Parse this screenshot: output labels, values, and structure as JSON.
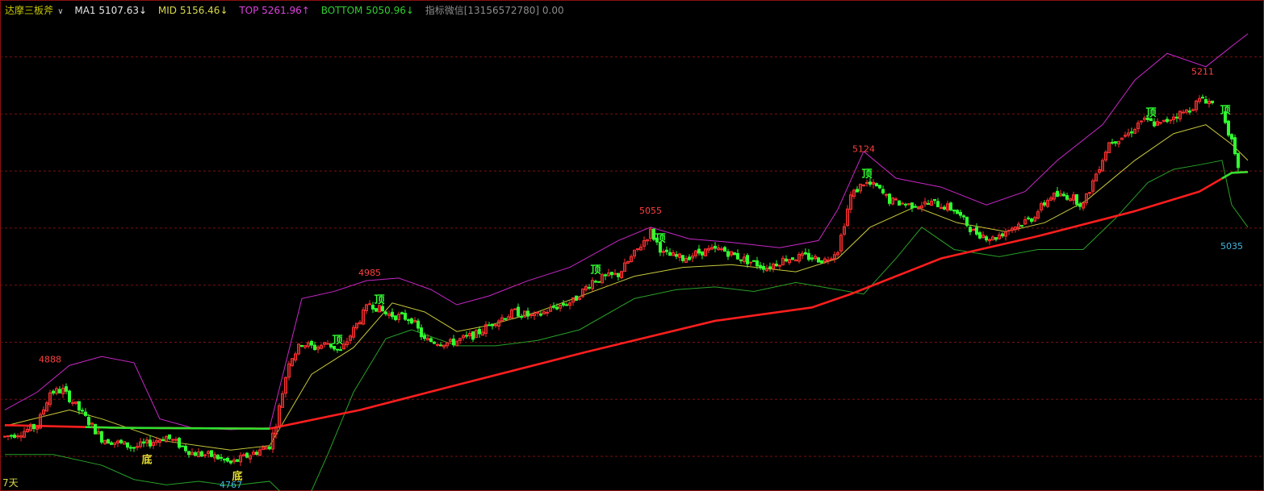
{
  "legend": {
    "indicator_name": "达摩三板斧",
    "ma1": "MA1 5107.63",
    "ma1_arrow": "↓",
    "mid": "MID 5156.46",
    "mid_arrow": "↓",
    "top": "TOP 5261.96",
    "top_arrow": "↑",
    "bottom": "BOTTOM 5050.96",
    "bottom_arrow": "↓",
    "note": "指标微信[13156572780] 0.00"
  },
  "period_label": "7天",
  "colors": {
    "up": "#ff3030",
    "down": "#30ff30",
    "mid_line": "#c8c83c",
    "top_band": "#c828c8",
    "bottom_band": "#28a028",
    "ma_line": "#ff1e1e",
    "ma_line_flat": "#30e030",
    "grid": "#7a1010",
    "label_high": "#ff4040",
    "label_low": "#40b8e0",
    "top_mark": "#30ff30",
    "bottom_mark": "#e8e030"
  },
  "chart_data": {
    "type": "candlestick",
    "ylim": [
      4750,
      5280
    ],
    "y_gridlines": [
      4788,
      4852,
      4916,
      4980,
      5044,
      5108,
      5172,
      5236
    ],
    "annotations": [
      {
        "text": "4888",
        "kind": "high",
        "bar": 14,
        "value": 4888
      },
      {
        "text": "4767",
        "kind": "low",
        "bar": 70,
        "value": 4767
      },
      {
        "text": "4985",
        "kind": "high",
        "bar": 113,
        "value": 4985
      },
      {
        "text": "5055",
        "kind": "high",
        "bar": 200,
        "value": 5055
      },
      {
        "text": "5124",
        "kind": "high",
        "bar": 266,
        "value": 5124
      },
      {
        "text": "5211",
        "kind": "high",
        "bar": 371,
        "value": 5211
      },
      {
        "text": "5035",
        "kind": "low",
        "bar": 380,
        "value": 5035
      }
    ],
    "signal_marks": [
      {
        "text": "底",
        "kind": "bottom",
        "bar": 44
      },
      {
        "text": "底",
        "kind": "bottom",
        "bar": 72
      },
      {
        "text": "顶",
        "kind": "top",
        "bar": 103
      },
      {
        "text": "顶",
        "kind": "top",
        "bar": 116
      },
      {
        "text": "顶",
        "kind": "top",
        "bar": 183
      },
      {
        "text": "顶",
        "kind": "top",
        "bar": 203
      },
      {
        "text": "顶",
        "kind": "top",
        "bar": 267
      },
      {
        "text": "顶",
        "kind": "top",
        "bar": 355
      },
      {
        "text": "顶",
        "kind": "top",
        "bar": 378
      }
    ],
    "price_path": [
      [
        0,
        4810
      ],
      [
        5,
        4815
      ],
      [
        10,
        4822
      ],
      [
        14,
        4860
      ],
      [
        18,
        4862
      ],
      [
        22,
        4845
      ],
      [
        30,
        4808
      ],
      [
        40,
        4798
      ],
      [
        44,
        4802
      ],
      [
        50,
        4810
      ],
      [
        58,
        4792
      ],
      [
        65,
        4788
      ],
      [
        70,
        4780
      ],
      [
        76,
        4790
      ],
      [
        82,
        4800
      ],
      [
        84,
        4825
      ],
      [
        88,
        4895
      ],
      [
        92,
        4915
      ],
      [
        96,
        4910
      ],
      [
        100,
        4915
      ],
      [
        104,
        4905
      ],
      [
        108,
        4930
      ],
      [
        113,
        4960
      ],
      [
        118,
        4948
      ],
      [
        126,
        4942
      ],
      [
        130,
        4918
      ],
      [
        138,
        4915
      ],
      [
        146,
        4925
      ],
      [
        152,
        4940
      ],
      [
        158,
        4950
      ],
      [
        164,
        4944
      ],
      [
        170,
        4955
      ],
      [
        176,
        4962
      ],
      [
        182,
        4985
      ],
      [
        190,
        4992
      ],
      [
        196,
        5020
      ],
      [
        200,
        5040
      ],
      [
        204,
        5015
      ],
      [
        210,
        5010
      ],
      [
        216,
        5018
      ],
      [
        222,
        5020
      ],
      [
        228,
        5010
      ],
      [
        232,
        5005
      ],
      [
        236,
        5000
      ],
      [
        242,
        5010
      ],
      [
        248,
        5012
      ],
      [
        254,
        5008
      ],
      [
        258,
        5020
      ],
      [
        262,
        5080
      ],
      [
        266,
        5095
      ],
      [
        270,
        5090
      ],
      [
        274,
        5075
      ],
      [
        280,
        5070
      ],
      [
        288,
        5072
      ],
      [
        294,
        5065
      ],
      [
        300,
        5040
      ],
      [
        306,
        5032
      ],
      [
        312,
        5045
      ],
      [
        318,
        5055
      ],
      [
        324,
        5080
      ],
      [
        330,
        5080
      ],
      [
        334,
        5070
      ],
      [
        338,
        5105
      ],
      [
        342,
        5140
      ],
      [
        348,
        5150
      ],
      [
        352,
        5165
      ],
      [
        358,
        5160
      ],
      [
        362,
        5170
      ],
      [
        366,
        5175
      ],
      [
        371,
        5190
      ],
      [
        376,
        5180
      ],
      [
        378,
        5165
      ],
      [
        380,
        5140
      ],
      [
        382,
        5108
      ]
    ],
    "ma1_path": [
      [
        0,
        4823
      ],
      [
        35,
        4820
      ],
      [
        82,
        4819
      ],
      [
        86,
        4822
      ],
      [
        110,
        4840
      ],
      [
        140,
        4868
      ],
      [
        180,
        4905
      ],
      [
        220,
        4940
      ],
      [
        250,
        4955
      ],
      [
        262,
        4970
      ],
      [
        290,
        5010
      ],
      [
        320,
        5035
      ],
      [
        350,
        5063
      ],
      [
        370,
        5085
      ],
      [
        380,
        5106
      ],
      [
        385,
        5107
      ]
    ],
    "ma1_flat_range": [
      25,
      82
    ],
    "ma1_tail_flat": [
      377,
      385
    ],
    "mid_path": [
      [
        0,
        4822
      ],
      [
        20,
        4840
      ],
      [
        30,
        4830
      ],
      [
        50,
        4805
      ],
      [
        70,
        4795
      ],
      [
        82,
        4800
      ],
      [
        95,
        4880
      ],
      [
        108,
        4910
      ],
      [
        120,
        4960
      ],
      [
        130,
        4950
      ],
      [
        140,
        4928
      ],
      [
        150,
        4935
      ],
      [
        165,
        4950
      ],
      [
        180,
        4970
      ],
      [
        195,
        4990
      ],
      [
        210,
        5000
      ],
      [
        225,
        5003
      ],
      [
        245,
        4995
      ],
      [
        258,
        5010
      ],
      [
        268,
        5045
      ],
      [
        282,
        5068
      ],
      [
        295,
        5050
      ],
      [
        310,
        5040
      ],
      [
        322,
        5050
      ],
      [
        335,
        5075
      ],
      [
        350,
        5120
      ],
      [
        362,
        5150
      ],
      [
        372,
        5160
      ],
      [
        380,
        5138
      ],
      [
        385,
        5120
      ]
    ],
    "top_path": [
      [
        0,
        4840
      ],
      [
        10,
        4860
      ],
      [
        20,
        4890
      ],
      [
        30,
        4900
      ],
      [
        40,
        4893
      ],
      [
        48,
        4830
      ],
      [
        58,
        4820
      ],
      [
        70,
        4818
      ],
      [
        82,
        4820
      ],
      [
        92,
        4965
      ],
      [
        102,
        4973
      ],
      [
        112,
        4985
      ],
      [
        122,
        4988
      ],
      [
        132,
        4975
      ],
      [
        140,
        4958
      ],
      [
        150,
        4968
      ],
      [
        162,
        4985
      ],
      [
        175,
        5000
      ],
      [
        190,
        5030
      ],
      [
        200,
        5045
      ],
      [
        212,
        5032
      ],
      [
        225,
        5028
      ],
      [
        240,
        5022
      ],
      [
        252,
        5030
      ],
      [
        258,
        5065
      ],
      [
        266,
        5130
      ],
      [
        276,
        5100
      ],
      [
        290,
        5090
      ],
      [
        304,
        5070
      ],
      [
        316,
        5085
      ],
      [
        326,
        5120
      ],
      [
        340,
        5160
      ],
      [
        350,
        5210
      ],
      [
        360,
        5240
      ],
      [
        372,
        5225
      ],
      [
        380,
        5248
      ],
      [
        385,
        5262
      ]
    ],
    "bottom_path": [
      [
        0,
        4790
      ],
      [
        15,
        4790
      ],
      [
        30,
        4778
      ],
      [
        40,
        4762
      ],
      [
        50,
        4756
      ],
      [
        60,
        4760
      ],
      [
        70,
        4755
      ],
      [
        82,
        4760
      ],
      [
        92,
        4725
      ],
      [
        100,
        4790
      ],
      [
        108,
        4860
      ],
      [
        118,
        4920
      ],
      [
        126,
        4930
      ],
      [
        140,
        4912
      ],
      [
        152,
        4912
      ],
      [
        165,
        4918
      ],
      [
        178,
        4930
      ],
      [
        195,
        4965
      ],
      [
        208,
        4975
      ],
      [
        220,
        4978
      ],
      [
        232,
        4973
      ],
      [
        245,
        4983
      ],
      [
        258,
        4975
      ],
      [
        266,
        4970
      ],
      [
        276,
        5010
      ],
      [
        284,
        5045
      ],
      [
        294,
        5020
      ],
      [
        308,
        5012
      ],
      [
        320,
        5020
      ],
      [
        334,
        5020
      ],
      [
        344,
        5055
      ],
      [
        354,
        5095
      ],
      [
        362,
        5110
      ],
      [
        370,
        5115
      ],
      [
        377,
        5120
      ],
      [
        380,
        5070
      ],
      [
        385,
        5045
      ]
    ]
  }
}
